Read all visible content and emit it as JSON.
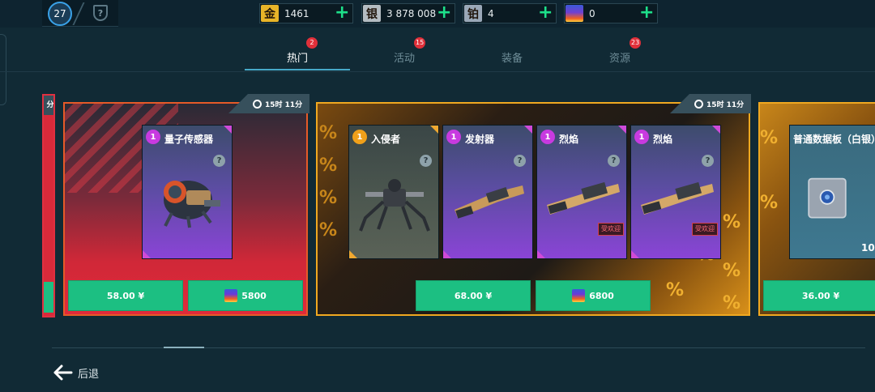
{
  "header": {
    "level": "27",
    "currencies": [
      {
        "icon": "gold-currency-icon",
        "glyph": "金",
        "value": "1461",
        "color": "#e8b428"
      },
      {
        "icon": "silver-currency-icon",
        "glyph": "银",
        "value": "3 878 008",
        "color": "#b4bcc2"
      },
      {
        "icon": "platinum-currency-icon",
        "glyph": "铂",
        "value": "4",
        "color": "#9aa8b8"
      },
      {
        "icon": "fire-currency-icon",
        "glyph": "",
        "value": "0",
        "color": "#4a5ad8"
      }
    ],
    "plus_glyph": "+"
  },
  "tabs": [
    {
      "label": "热门",
      "badge": "2",
      "active": true
    },
    {
      "label": "活动",
      "badge": "15",
      "active": false
    },
    {
      "label": "装备",
      "badge": "",
      "active": false
    },
    {
      "label": "资源",
      "badge": "23",
      "active": false
    }
  ],
  "offers": [
    {
      "id": "left-partial",
      "timer": "分",
      "buttons": []
    },
    {
      "id": "quantum-sensor",
      "timer": "15时 11分",
      "items": [
        {
          "qty": "1",
          "name": "量子传感器",
          "help": "?",
          "popular": ""
        }
      ],
      "buttons": [
        {
          "label": "58.00 ¥",
          "type": "price"
        },
        {
          "label": "5800",
          "type": "fire"
        }
      ]
    },
    {
      "id": "invader-bundle",
      "timer": "15时 11分",
      "items": [
        {
          "qty": "1",
          "name": "入侵者",
          "help": "?",
          "popular": ""
        },
        {
          "qty": "1",
          "name": "发射器",
          "help": "?",
          "popular": ""
        },
        {
          "qty": "1",
          "name": "烈焰",
          "help": "?",
          "popular": "受欢迎"
        },
        {
          "qty": "1",
          "name": "烈焰",
          "help": "?",
          "popular": "受欢迎"
        }
      ],
      "buttons": [
        {
          "label": "68.00 ¥",
          "type": "price"
        },
        {
          "label": "6800",
          "type": "fire"
        }
      ]
    },
    {
      "id": "data-pad",
      "timer": "",
      "items": [
        {
          "qty": "",
          "name": "普通数据板（白银）",
          "help": "",
          "popular": "",
          "count": "10"
        }
      ],
      "buttons": [
        {
          "label": "36.00 ¥",
          "type": "price"
        }
      ]
    }
  ],
  "decor": {
    "percent": "%"
  },
  "footer": {
    "back_label": "后退"
  }
}
